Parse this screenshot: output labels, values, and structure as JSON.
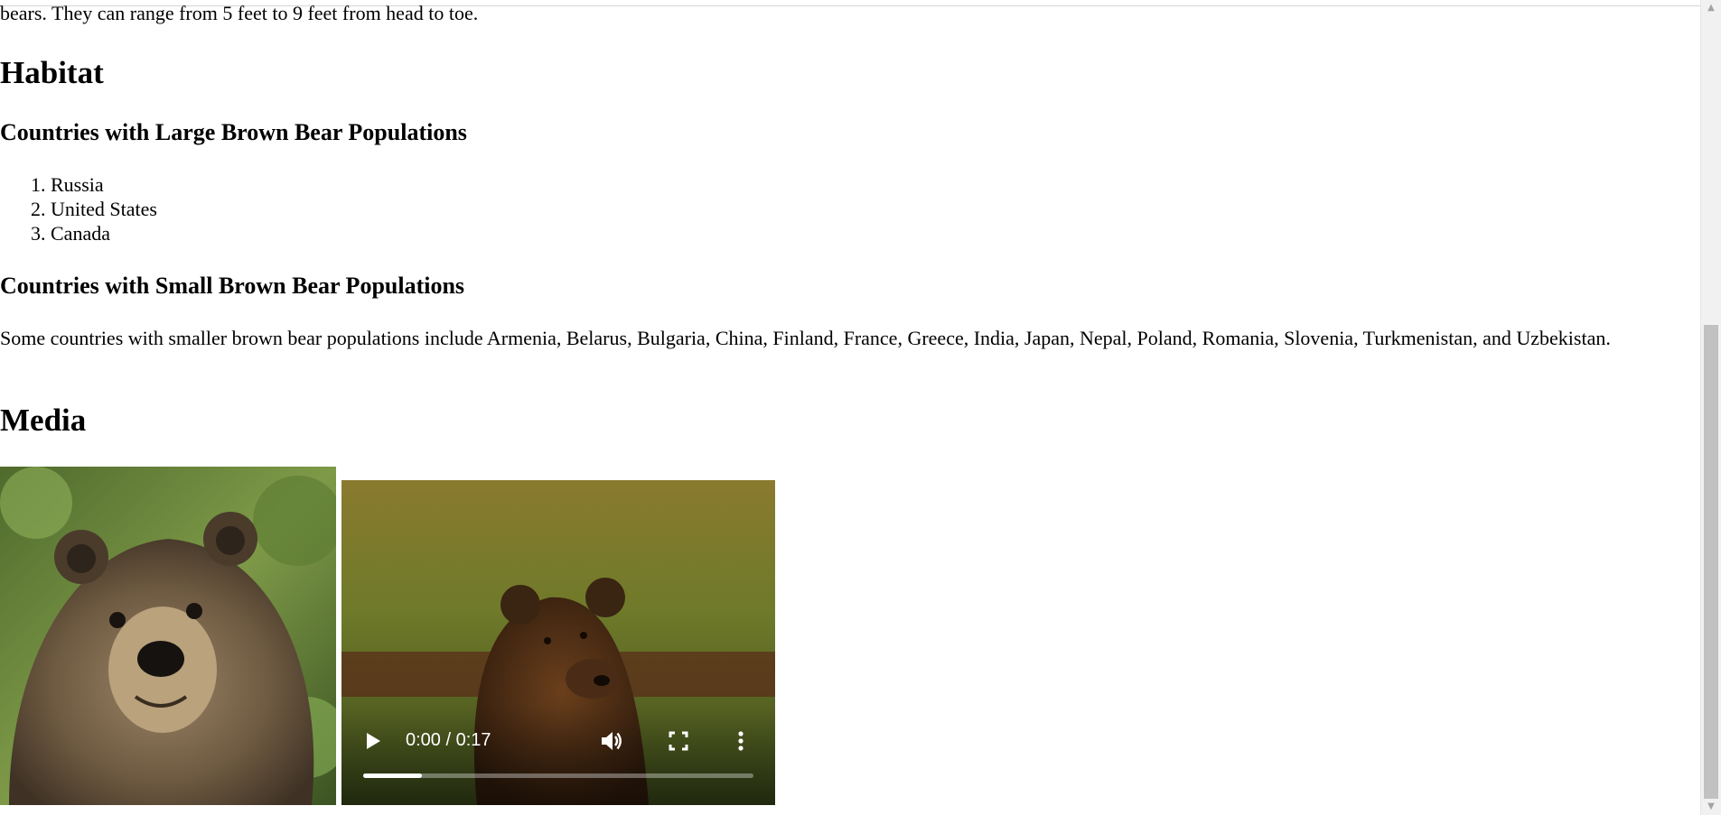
{
  "article": {
    "cutoff_text": "bears. They can range from 5 feet to 9 feet from head to toe.",
    "habitat_heading": "Habitat",
    "large_heading": "Countries with Large Brown Bear Populations",
    "large_list": [
      "Russia",
      "United States",
      "Canada"
    ],
    "small_heading": "Countries with Small Brown Bear Populations",
    "small_paragraph": "Some countries with smaller brown bear populations include Armenia, Belarus, Bulgaria, China, Finland, France, Greece, India, Japan, Nepal, Poland, Romania, Slovenia, Turkmenistan, and Uzbekistan.",
    "media_heading": "Media"
  },
  "video": {
    "time": "0:00 / 0:17",
    "progress_fraction": 0.15,
    "play_icon": "play-icon",
    "volume_icon": "volume-icon",
    "fullscreen_icon": "fullscreen-icon",
    "more_icon": "more-vertical-icon"
  },
  "scrollbar": {
    "up_icon": "scroll-up-arrow-icon",
    "down_icon": "scroll-down-arrow-icon"
  }
}
